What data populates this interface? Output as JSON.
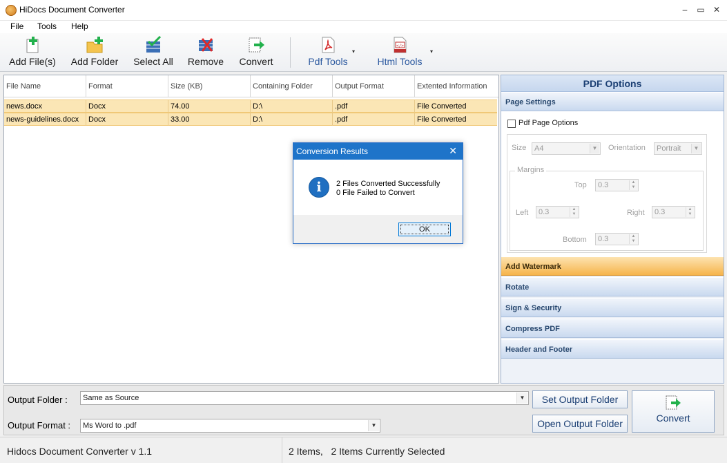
{
  "window": {
    "title": "HiDocs Document Converter",
    "minimize": "–",
    "maximize": "▭",
    "close": "✕"
  },
  "menu": {
    "file": "File",
    "tools": "Tools",
    "help": "Help"
  },
  "toolbar": {
    "add_files": "Add File(s)",
    "add_folder": "Add Folder",
    "select_all": "Select All",
    "remove": "Remove",
    "convert": "Convert",
    "pdf_tools": "Pdf Tools",
    "html_tools": "Html Tools",
    "dropdown_glyph": "▾"
  },
  "grid": {
    "columns": [
      "File Name",
      "Format",
      "Size (KB)",
      "Containing Folder",
      "Output Format",
      "Extented Information"
    ],
    "rows": [
      [
        "news.docx",
        "Docx",
        "74.00",
        "D:\\",
        ".pdf",
        "File Converted"
      ],
      [
        "news-guidelines.docx",
        "Docx",
        "33.00",
        "D:\\",
        ".pdf",
        "File Converted"
      ]
    ],
    "row_highlight": "#fbe6b5"
  },
  "dialog": {
    "title": "Conversion Results",
    "close": "✕",
    "icon_glyph": "i",
    "line1": "2 Files Converted Successfully",
    "line2": "0 File Failed to Convert",
    "ok": "OK"
  },
  "panel": {
    "title": "PDF Options",
    "page_settings": "Page Settings",
    "pdf_page_options": "Pdf Page Options",
    "pdf_page_options_checked": false,
    "size_label": "Size",
    "size_value": "A4",
    "orientation_label": "Orientation",
    "orientation_value": "Portrait",
    "margins_label": "Margins",
    "top_label": "Top",
    "top_value": "0.3",
    "left_label": "Left",
    "left_value": "0.3",
    "right_label": "Right",
    "right_value": "0.3",
    "bottom_label": "Bottom",
    "bottom_value": "0.3",
    "sections": [
      "Add Watermark",
      "Rotate",
      "Sign & Security",
      "Compress PDF",
      "Header and Footer"
    ]
  },
  "bottom": {
    "output_folder_label": "Output Folder :",
    "output_folder_value": "Same as Source",
    "output_format_label": "Output Format :",
    "output_format_value": "Ms Word to .pdf",
    "set_output_folder": "Set Output Folder",
    "open_output_folder": "Open Output Folder",
    "convert": "Convert",
    "combo_arrow": "▼"
  },
  "status": {
    "version": "Hidocs Document Converter v 1.1",
    "items": "2 Items,   2 Items Currently Selected"
  },
  "colors": {
    "accent": "#1e74c9",
    "panel_header": "#1a3e73",
    "active_section": "#f6b44b"
  }
}
